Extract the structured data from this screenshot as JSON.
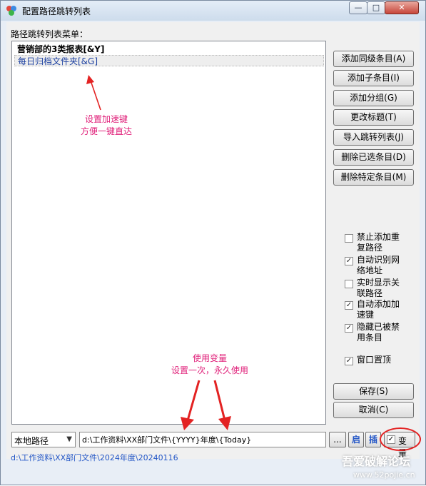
{
  "window": {
    "title": "配置路径跳转列表"
  },
  "titlebar": {
    "min_glyph": "—",
    "max_glyph": "□",
    "close_glyph": "✕"
  },
  "list": {
    "caption": "路径跳转列表菜单：",
    "items": [
      {
        "label": "营销部的3类报表[&Y]"
      },
      {
        "label": "每日归档文件夹[&G]"
      }
    ]
  },
  "buttons": {
    "add_sibling": "添加同级条目(A)",
    "add_child": "添加子条目(I)",
    "add_group": "添加分组(G)",
    "rename_title": "更改标题(T)",
    "import_list": "导入跳转列表(J)",
    "delete_selected": "删除已选条目(D)",
    "delete_specific": "删除特定条目(M)",
    "save": "保存(S)",
    "cancel": "取消(C)"
  },
  "options": [
    {
      "label": "禁止添加重复路径",
      "checked": false
    },
    {
      "label": "自动识别网络地址",
      "checked": true
    },
    {
      "label": "实时显示关联路径",
      "checked": false
    },
    {
      "label": "自动添加加速键",
      "checked": true
    },
    {
      "label": "隐藏已被禁用条目",
      "checked": true
    },
    {
      "label": "窗口置顶",
      "checked": true
    }
  ],
  "annotations": {
    "accelerator_line1": "设置加速键",
    "accelerator_line2": "方便一键直达",
    "variables_line1": "使用变量",
    "variables_line2": "设置一次，永久使用"
  },
  "bottom": {
    "path_type": "本地路径",
    "path_value": "d:\\工作资料\\XX部门文件\\{YYYY}年度\\{Today}",
    "ellipsis_label": "...",
    "qi_label": "启",
    "cha_label": "插",
    "variable_label": "变量",
    "variable_checked": true,
    "resolved_path": "d:\\工作资料\\XX部门文件\\2024年度\\20240116"
  },
  "watermark": {
    "logo": "吾爱破解论坛",
    "url": "www.52pojie.cn"
  },
  "colors": {
    "annotation": "#e0217a",
    "arrow": "#e32222",
    "link_blue": "#2356c6"
  },
  "icons": {
    "check": "✓",
    "dropdown": "▼"
  }
}
